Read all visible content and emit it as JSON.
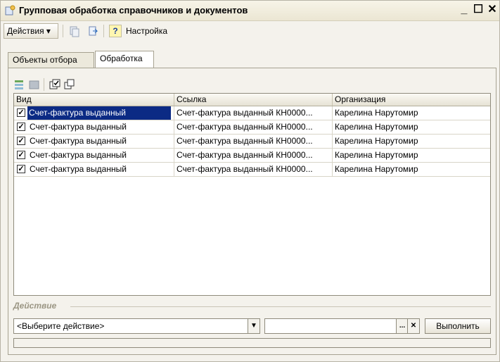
{
  "window": {
    "title": "Групповая обработка справочников и документов",
    "minimize": "_",
    "maximize": "☐",
    "close": "✕"
  },
  "toolbar": {
    "actions_label": "Действия",
    "actions_arrow": "▾",
    "help_label": "?",
    "settings_label": "Настройка"
  },
  "tabs": [
    {
      "label": "Объекты отбора"
    },
    {
      "label": "Обработка"
    }
  ],
  "grid": {
    "columns": [
      "Вид",
      "Ссылка",
      "Организация"
    ],
    "rows": [
      {
        "checked": true,
        "kind": "Счет-фактура выданный",
        "link": "Счет-фактура выданный КН0000...",
        "org": "Карелина Нарутомир"
      },
      {
        "checked": true,
        "kind": "Счет-фактура выданный",
        "link": "Счет-фактура выданный КН0000...",
        "org": "Карелина Нарутомир"
      },
      {
        "checked": true,
        "kind": "Счет-фактура выданный",
        "link": "Счет-фактура выданный КН0000...",
        "org": "Карелина Нарутомир"
      },
      {
        "checked": true,
        "kind": "Счет-фактура выданный",
        "link": "Счет-фактура выданный КН0000...",
        "org": "Карелина Нарутомир"
      },
      {
        "checked": true,
        "kind": "Счет-фактура выданный",
        "link": "Счет-фактура выданный КН0000...",
        "org": "Карелина Нарутомир"
      }
    ]
  },
  "action": {
    "section_label": "Действие",
    "select_value": "<Выберите действие>",
    "select_arrow": "▼",
    "param_value": "",
    "dots_label": "...",
    "clear_label": "✕",
    "run_label": "Выполнить"
  }
}
